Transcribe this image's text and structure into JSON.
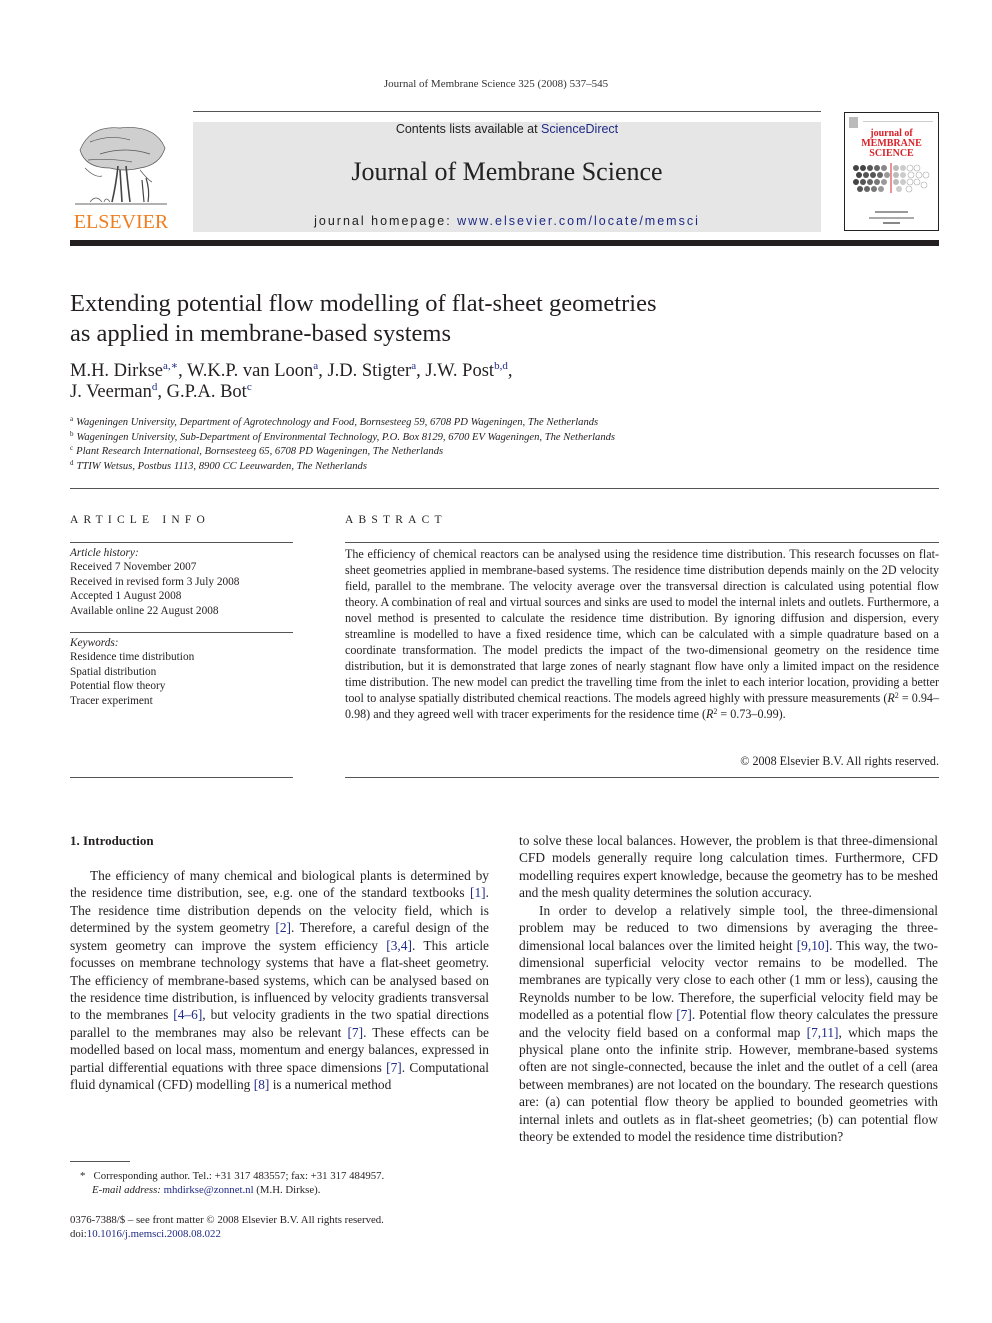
{
  "running_head": "Journal of Membrane Science 325 (2008) 537–545",
  "masthead": {
    "publisher_logo_word": "ELSEVIER",
    "contents_prefix": "Contents lists available at ",
    "contents_link": "ScienceDirect",
    "journal_title": "Journal of Membrane Science",
    "homepage_prefix": "journal homepage: ",
    "homepage_link": "www.elsevier.com/locate/memsci",
    "cover": {
      "line1": "journal of",
      "line2": "MEMBRANE",
      "line3": "SCIENCE"
    },
    "colors": {
      "elsevier_orange": "#f07e1e",
      "link_blue": "#1f2a85",
      "cover_red": "#d8232a",
      "banner_gray": "#e6e6e6"
    }
  },
  "article": {
    "title_line1": "Extending potential flow modelling of flat-sheet geometries",
    "title_line2": "as applied in membrane-based systems",
    "authors": [
      {
        "name": "M.H. Dirkse",
        "sup": "a,∗",
        "sep": ", "
      },
      {
        "name": "W.K.P. van Loon",
        "sup": "a",
        "sep": ", "
      },
      {
        "name": "J.D. Stigter",
        "sup": "a",
        "sep": ", "
      },
      {
        "name": "J.W. Post",
        "sup": "b,d",
        "sep": ","
      },
      {
        "name": "J. Veerman",
        "sup": "d",
        "sep": ", "
      },
      {
        "name": "G.P.A. Bot",
        "sup": "c",
        "sep": ""
      }
    ],
    "affiliations": [
      {
        "key": "a",
        "text": "Wageningen University, Department of Agrotechnology and Food, Bornsesteeg 59, 6708 PD Wageningen, The Netherlands"
      },
      {
        "key": "b",
        "text": "Wageningen University, Sub-Department of Environmental Technology, P.O. Box 8129, 6700 EV Wageningen, The Netherlands"
      },
      {
        "key": "c",
        "text": "Plant Research International, Bornsesteeg 65, 6708 PD Wageningen, The Netherlands"
      },
      {
        "key": "d",
        "text": "TTIW Wetsus, Postbus 1113, 8900 CC Leeuwarden, The Netherlands"
      }
    ]
  },
  "article_info": {
    "heading": "ARTICLE INFO",
    "history_label": "Article history:",
    "history": [
      "Received 7 November 2007",
      "Received in revised form 3 July 2008",
      "Accepted 1 August 2008",
      "Available online 22 August 2008"
    ],
    "keywords_label": "Keywords:",
    "keywords": [
      "Residence time distribution",
      "Spatial distribution",
      "Potential flow theory",
      "Tracer experiment"
    ]
  },
  "abstract": {
    "heading": "ABSTRACT",
    "text_part1": "The efficiency of chemical reactors can be analysed using the residence time distribution. This research focusses on flat-sheet geometries applied in membrane-based systems. The residence time distribution depends mainly on the 2D velocity field, parallel to the membrane. The velocity average over the transver­sal direction is calculated using potential flow theory. A combination of real and virtual sources and sinks are used to model the internal inlets and outlets. Furthermore, a novel method is presented to calculate the residence time distribution. By ignoring diffusion and dispersion, every streamline is modelled to have a fixed residence time, which can be calculated with a simple quadrature based on a coordinate transformation. The model predicts the impact of the two-dimensional geometry on the residence time distribution, but it is demonstrated that large zones of nearly stagnant flow have only a limited impact on the residence time distribution. The new model can predict the travelling time from the inlet to each interior location, providing a better tool to analyse spatially distributed chemical reactions. The models agreed highly with pressure measurements (",
    "r2_symbol": "R",
    "r2_exp": "2",
    "r2_range_pressure": " = 0.94–0.98",
    "text_part2": ") and they agreed well with tracer experiments for the residence time (",
    "r2_range_tracer": " = 0.73–0.99",
    "text_part3": ").",
    "copyright": "© 2008 Elsevier B.V. All rights reserved."
  },
  "introduction": {
    "heading": "1.  Introduction",
    "left_col": [
      {
        "t": "The efficiency of many chemical and biological plants is deter­mined by the residence time distribution, see, e.g. one of the standard textbooks "
      },
      {
        "r": "[1]"
      },
      {
        "t": ". The residence time distribution depends on the velocity field, which is determined by the system geom­etry "
      },
      {
        "r": "[2]"
      },
      {
        "t": ". Therefore, a careful design of the system geometry can improve the system efficiency "
      },
      {
        "r": "[3,4]"
      },
      {
        "t": ". This article focusses on mem­brane technology systems that have a flat-sheet geometry. The efficiency of membrane-based systems, which can be analysed based on the residence time distribution, is influenced by velocity gradients transversal to the membranes "
      },
      {
        "r": "[4–6]"
      },
      {
        "t": ", but velocity gra­dients in the two spatial directions parallel to the membranes may also be relevant "
      },
      {
        "r": "[7]"
      },
      {
        "t": ". These effects can be modelled based on local mass, momentum and energy balances, expressed in partial differential equations with three space dimensions "
      },
      {
        "r": "[7]"
      },
      {
        "t": ". Computa­tional fluid dynamical (CFD) modelling "
      },
      {
        "r": "[8]"
      },
      {
        "t": " is a numerical method"
      }
    ],
    "right_p1": "to solve these local balances. However, the problem is that three-dimensional CFD models generally require long calculation times. Furthermore, CFD modelling requires expert knowledge, because the geometry has to be meshed and the mesh quality determines the solution accuracy.",
    "right_p2": [
      {
        "t": "In order to develop a relatively simple tool, the three-dimensional problem may be reduced to two dimensions by averaging the three-dimensional local balances over the limited height "
      },
      {
        "r": "[9,10]"
      },
      {
        "t": ". This way, the two-dimensional superficial velocity vector remains to be modelled. The membranes are typically very close to each other (1 mm or less), causing the Reynolds number to be low. Therefore, the superficial velocity field may be modelled as a potential flow "
      },
      {
        "r": "[7]"
      },
      {
        "t": ". Potential flow theory calculates the pressure and the velocity field based on a conformal map "
      },
      {
        "r": "[7,11]"
      },
      {
        "t": ", which maps the physical plane onto the infinite strip. However, membrane-based systems often are not single-connected, because the inlet and the outlet of a cell (area between membranes) are not located on the boundary. The research questions are: (a) can potential flow theory be applied to bounded geometries with internal inlets and outlets as in flat-sheet geometries; (b) can potential flow theory be extended to model the residence time distribution?"
      }
    ]
  },
  "footnote": {
    "marker": "*",
    "corresponding": "Corresponding author. Tel.: +31 317 483557; fax: +31 317 484957.",
    "email_label": "E-mail address: ",
    "email": "mhdirkse@zonnet.nl",
    "email_suffix": " (M.H. Dirkse)."
  },
  "front_matter": {
    "issn_line": "0376-7388/$ – see front matter © 2008 Elsevier B.V. All rights reserved.",
    "doi_prefix": "doi:",
    "doi": "10.1016/j.memsci.2008.08.022"
  }
}
